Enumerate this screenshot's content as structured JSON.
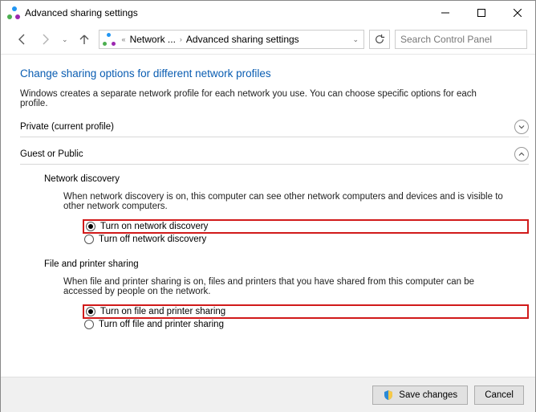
{
  "window": {
    "title": "Advanced sharing settings"
  },
  "breadcrumb": {
    "crumb1": "Network ...",
    "crumb2": "Advanced sharing settings"
  },
  "search": {
    "placeholder": "Search Control Panel"
  },
  "page": {
    "heading": "Change sharing options for different network profiles",
    "intro": "Windows creates a separate network profile for each network you use. You can choose specific options for each profile."
  },
  "sections": {
    "private_label": "Private (current profile)",
    "guest_label": "Guest or Public"
  },
  "network_discovery": {
    "title": "Network discovery",
    "desc": "When network discovery is on, this computer can see other network computers and devices and is visible to other network computers.",
    "on": "Turn on network discovery",
    "off": "Turn off network discovery"
  },
  "file_printer": {
    "title": "File and printer sharing",
    "desc": "When file and printer sharing is on, files and printers that you have shared from this computer can be accessed by people on the network.",
    "on": "Turn on file and printer sharing",
    "off": "Turn off file and printer sharing"
  },
  "footer": {
    "save": "Save changes",
    "cancel": "Cancel"
  }
}
